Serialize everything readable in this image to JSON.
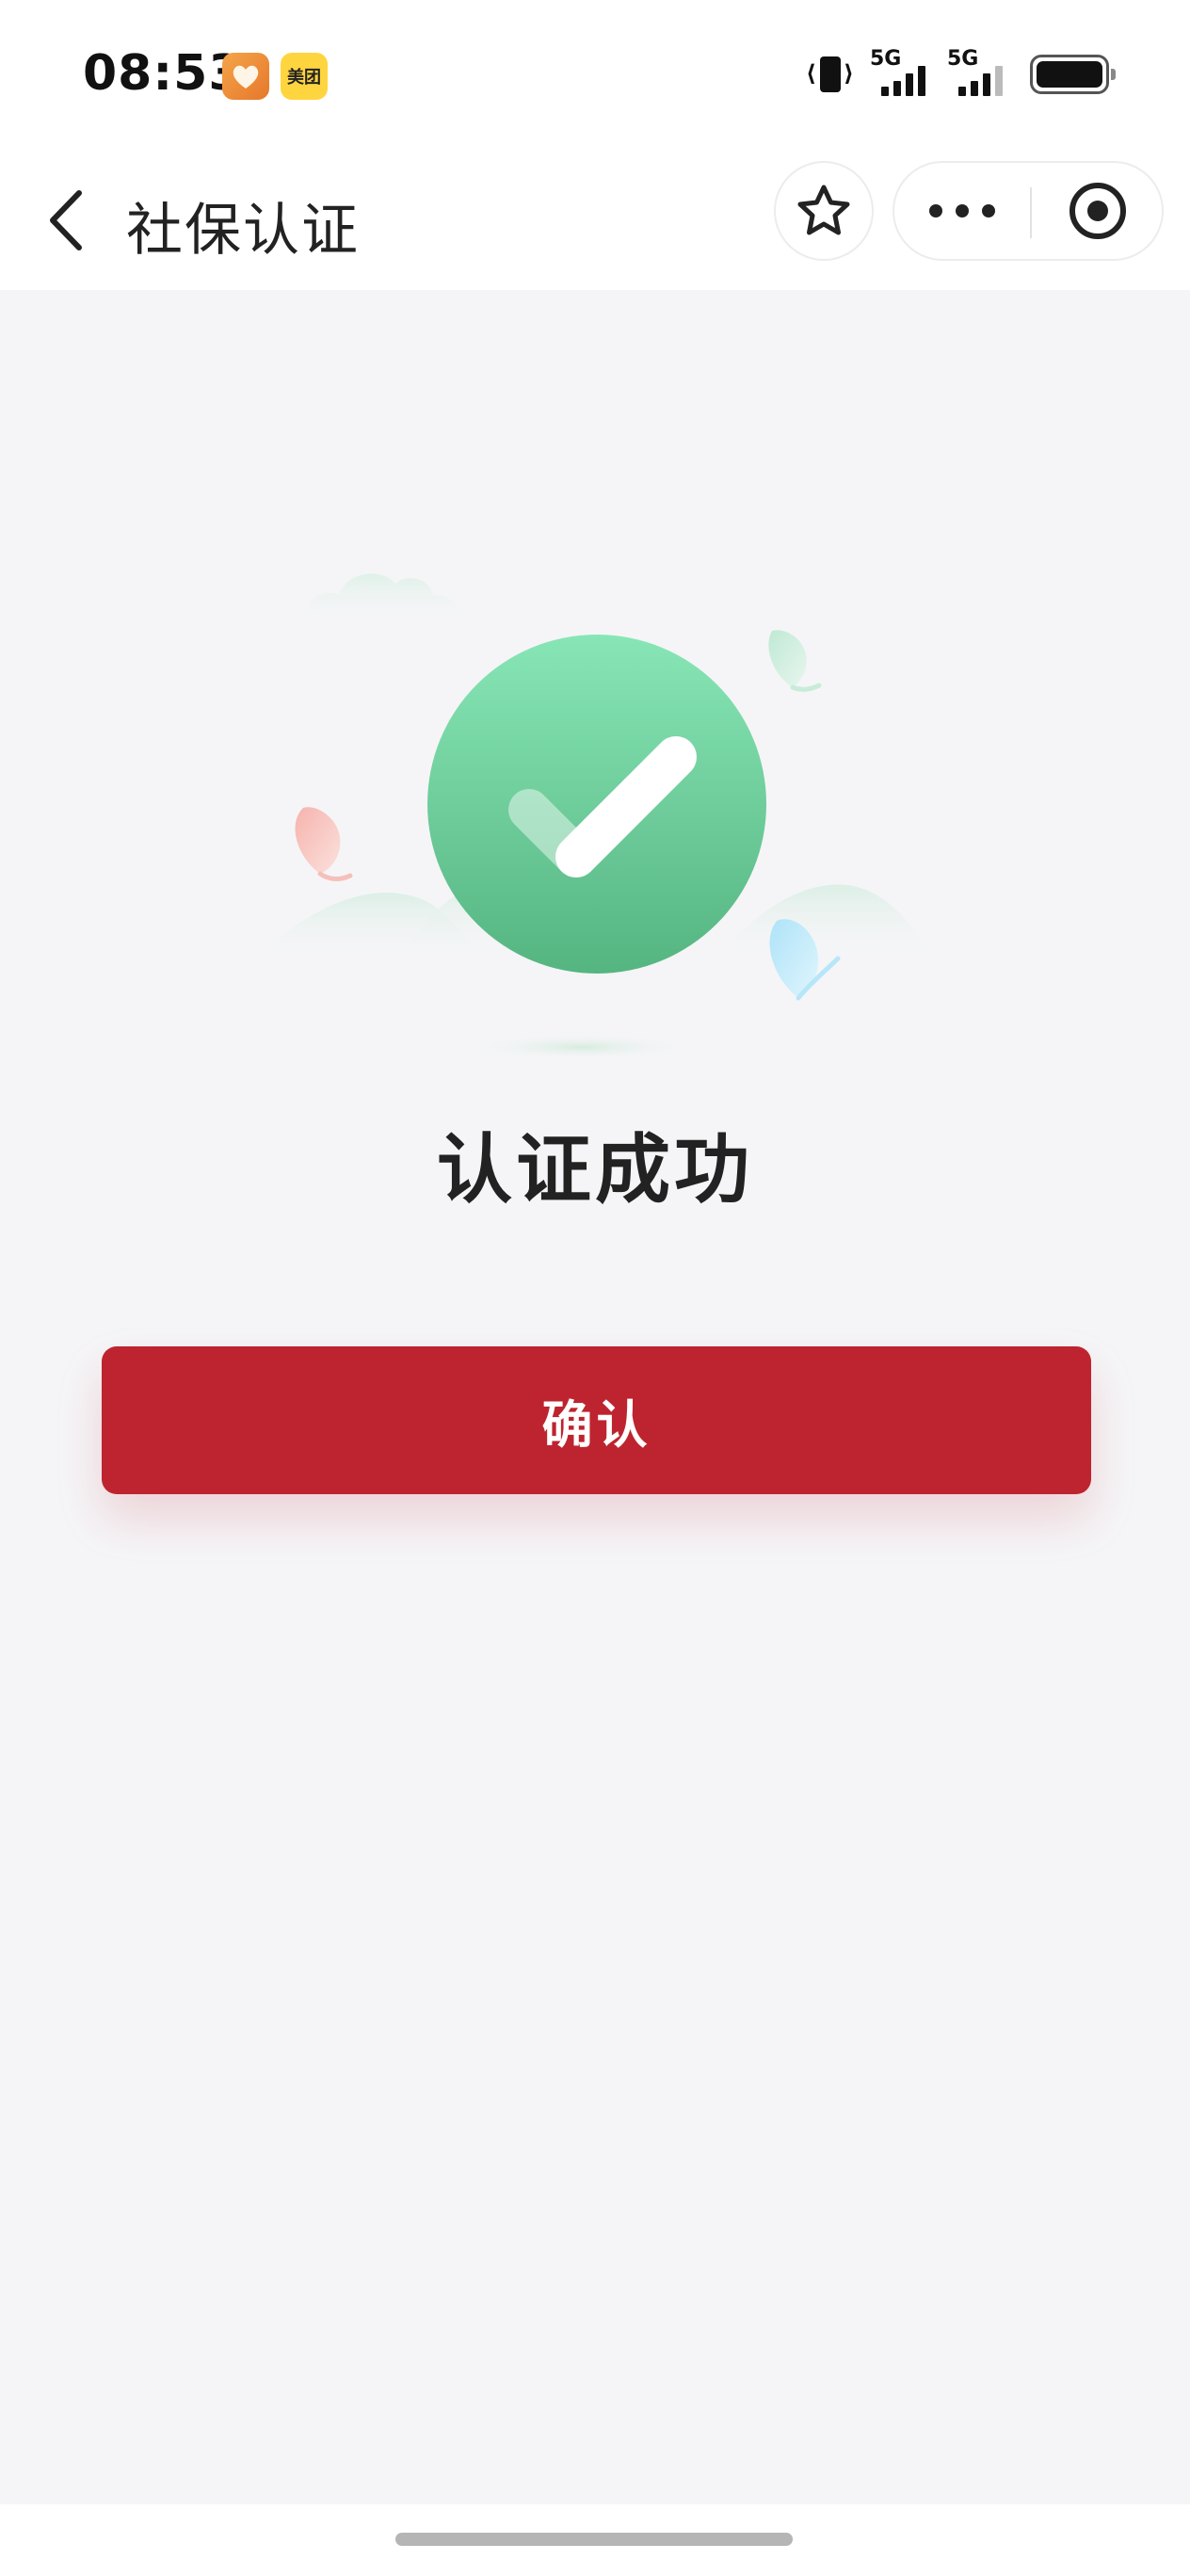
{
  "status_bar": {
    "time": "08:53",
    "badges": [
      {
        "icon": "heart-app-icon",
        "color": "#e6772b"
      },
      {
        "icon": "meituan-app-icon",
        "label": "美团",
        "color": "#ffd53f"
      }
    ],
    "signals": [
      {
        "label": "5G",
        "icon": "cellular-signal-icon"
      },
      {
        "label": "5G",
        "icon": "cellular-signal-icon"
      }
    ],
    "icons": [
      "vibrate-icon",
      "battery-icon"
    ]
  },
  "nav": {
    "title": "社保认证",
    "back_icon": "chevron-left-icon",
    "favorite_icon": "star-icon",
    "more_icon": "more-dots-icon",
    "close_icon": "target-circle-icon"
  },
  "result": {
    "icon": "success-check-icon",
    "title": "认证成功",
    "colors": {
      "check_circle_top": "#86e3b4",
      "check_circle_bottom": "#56b882"
    }
  },
  "actions": {
    "confirm_label": "确认",
    "confirm_color": "#be242f"
  }
}
